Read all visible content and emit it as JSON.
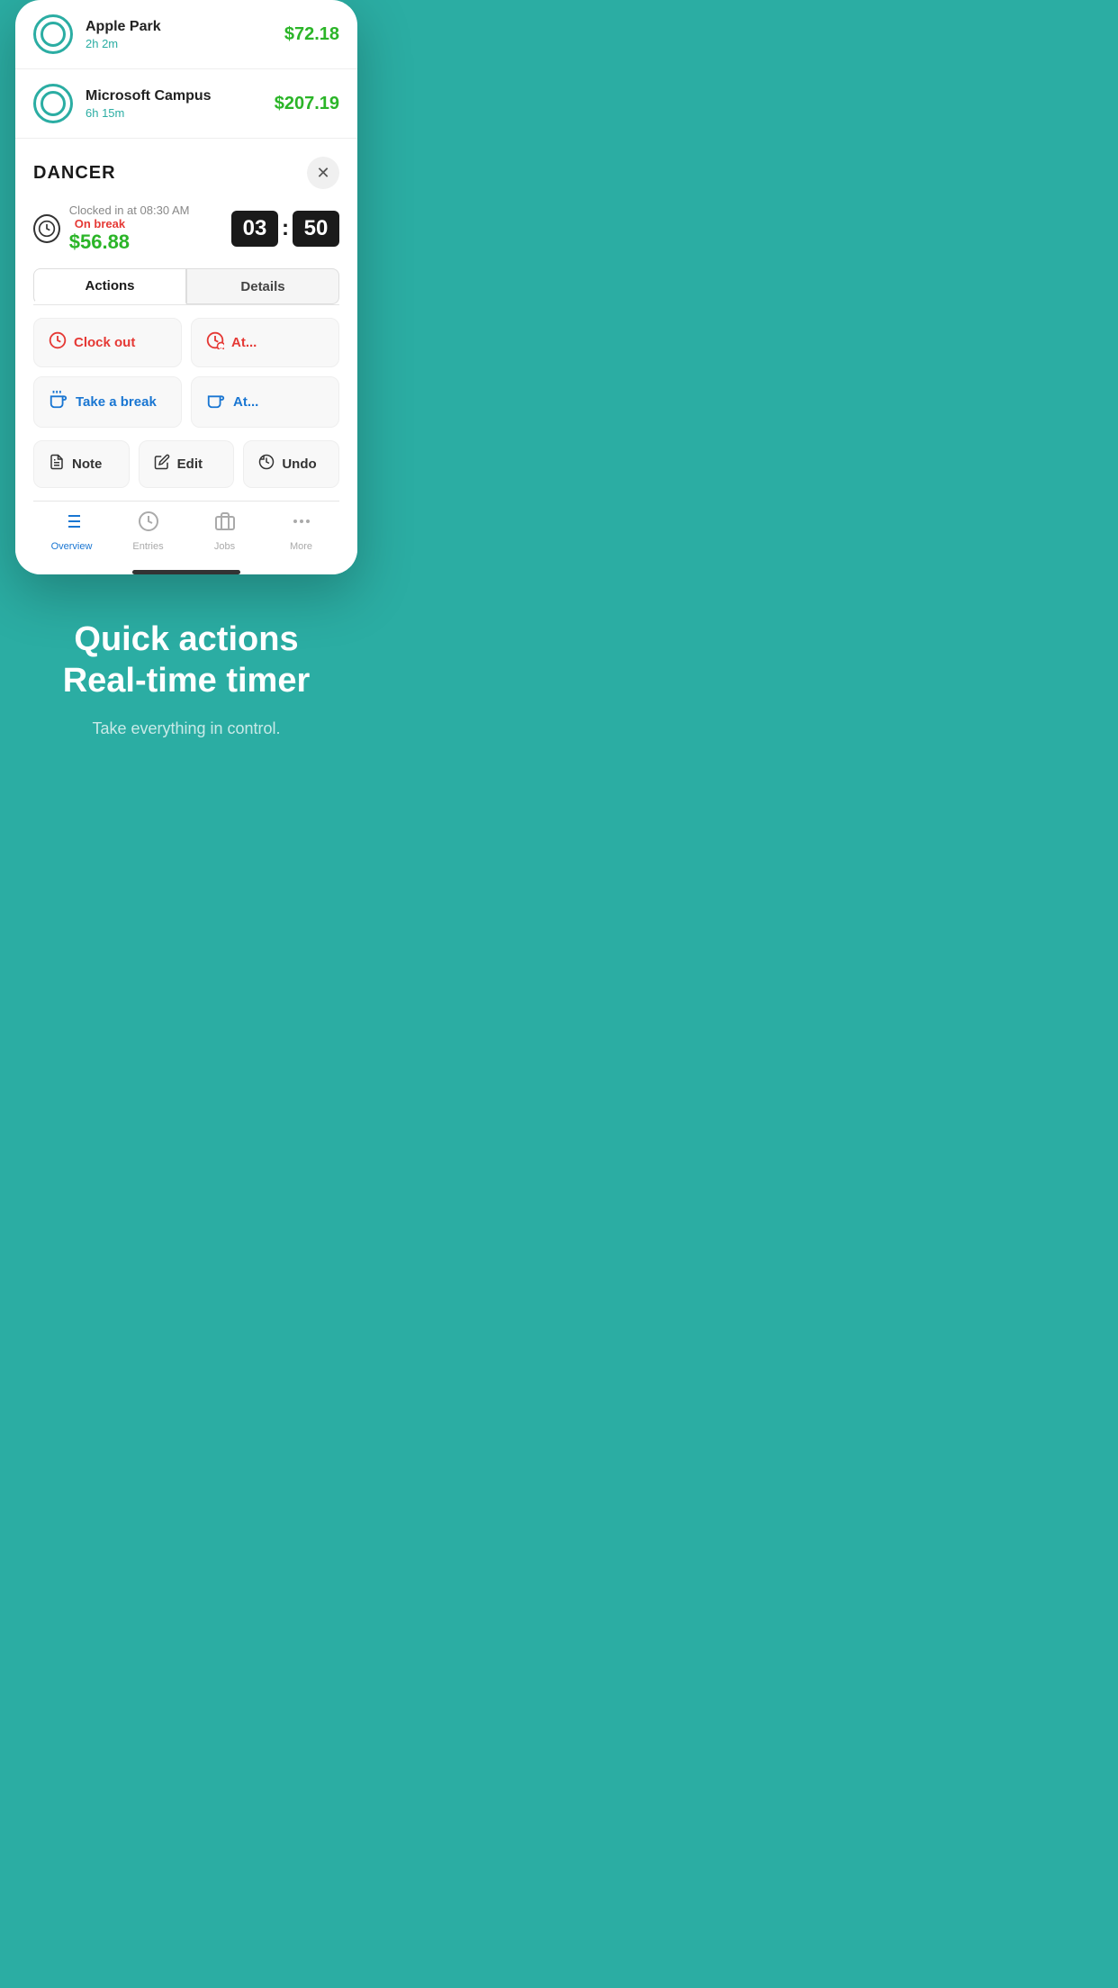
{
  "phone": {
    "jobs": [
      {
        "name": "Apple Park",
        "duration": "2h 2m",
        "amount": "$72.18",
        "icon": "circle"
      },
      {
        "name": "Microsoft Campus",
        "duration": "6h 15m",
        "amount": "$207.19",
        "icon": "circle"
      }
    ],
    "active_job": {
      "title": "DANCER",
      "clocked_in_text": "Clocked in at 08:30 AM",
      "on_break_text": "On break",
      "amount": "$56.88",
      "timer_hours": "03",
      "timer_minutes": "50"
    },
    "tabs": {
      "actions_label": "Actions",
      "details_label": "Details"
    },
    "action_buttons": {
      "clock_out": "Clock out",
      "at_clock": "At...",
      "take_break": "Take a break",
      "at_break": "At...",
      "note": "Note",
      "edit": "Edit",
      "undo": "Undo"
    },
    "bottom_nav": [
      {
        "label": "Overview",
        "active": true
      },
      {
        "label": "Entries",
        "active": false
      },
      {
        "label": "Jobs",
        "active": false
      },
      {
        "label": "More",
        "active": false
      }
    ]
  },
  "marketing": {
    "title": "Quick actions\nReal-time timer",
    "subtitle": "Take everything in control."
  },
  "colors": {
    "teal": "#2BADA3",
    "green": "#2BB528",
    "red": "#e53935",
    "blue": "#1976D2",
    "dark": "#1a1a1a"
  }
}
